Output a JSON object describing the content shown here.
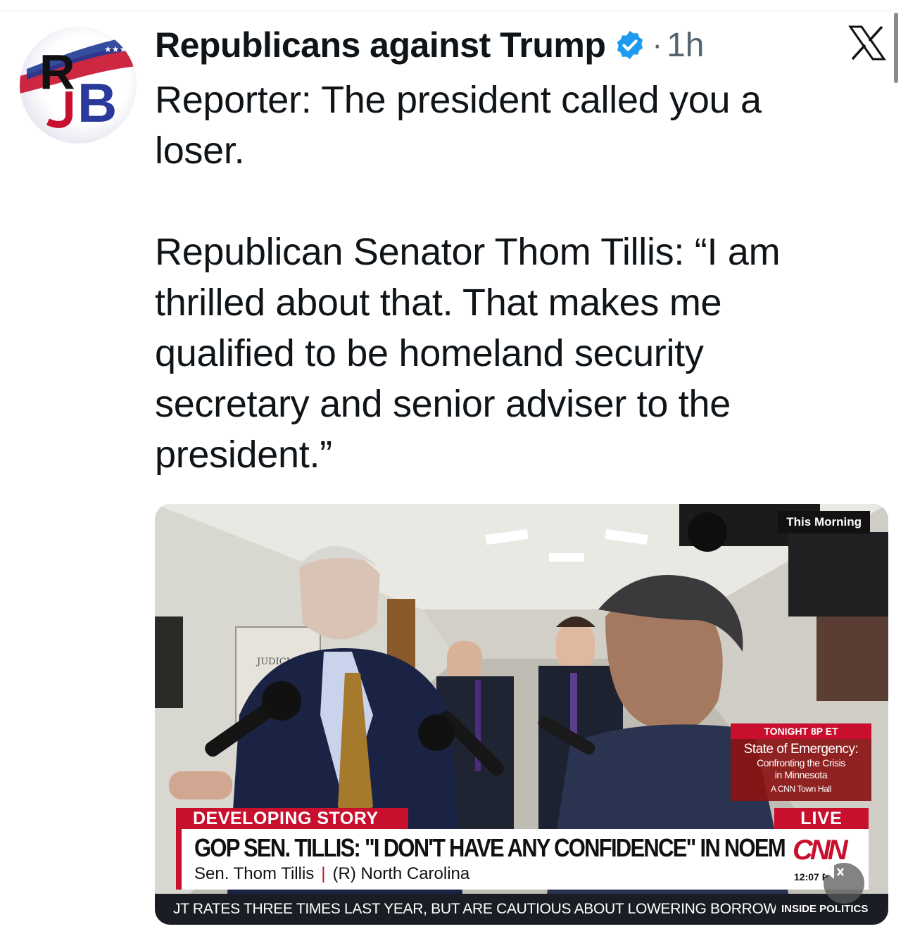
{
  "post": {
    "display_name": "Republicans against Trump",
    "verified": true,
    "separator": "·",
    "time": "1h",
    "text": "Reporter: The president called you a\nloser.\n\nRepublican Senator Thom Tillis: “I am\nthrilled about that. That makes me\nqualified to be homeland security\nsecretary and senior adviser to the\npresident.”"
  },
  "avatar": {
    "monogram": "RJB"
  },
  "icons": {
    "verified": "verified-badge-icon",
    "platform": "x-logo-icon",
    "mute": "muted-speaker-icon"
  },
  "colors": {
    "verified": "#1d9bf0",
    "cnn_red": "#c8102e",
    "ticker_bg": "#1b1d24"
  },
  "video": {
    "corner_tag": "This Morning",
    "promo": {
      "time": "TONIGHT 8P ET",
      "title": "State of Emergency:",
      "subtitle_1": "Confronting the Crisis",
      "subtitle_2": "in Minnesota",
      "label": "A CNN Town Hall"
    },
    "developing": "DEVELOPING STORY",
    "live": "LIVE",
    "headline": "GOP SEN. TILLIS: \"I DON'T HAVE ANY CONFIDENCE\" IN NOEM",
    "speaker_name": "Sen. Thom Tillis",
    "speaker_sep": "|",
    "speaker_state": "(R) North Carolina",
    "network": "CNN",
    "clock": "12:07 P",
    "ticker": "JT RATES THREE TIMES LAST YEAR, BUT ARE CAUTIOUS ABOUT LOWERING BORROWIN",
    "show": "INSIDE POLITICS",
    "sign_text": "JUDICI"
  }
}
